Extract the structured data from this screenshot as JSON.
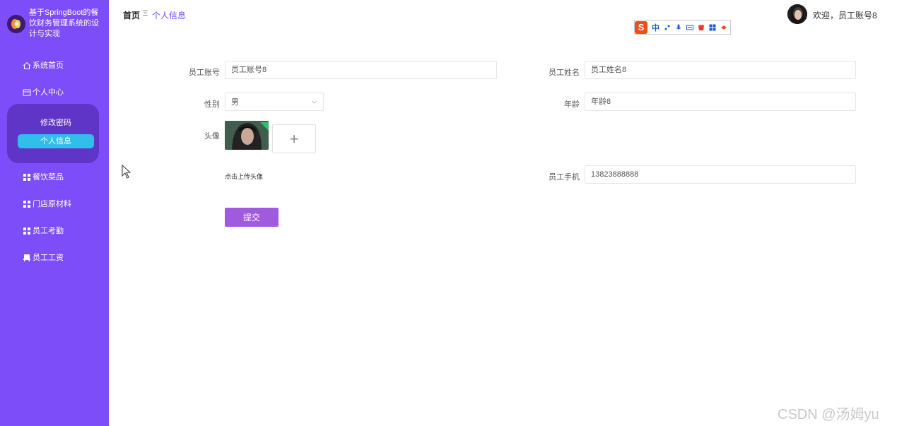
{
  "brand": {
    "title": "基于SpringBoot的餐饮财务管理系统的设计与实现"
  },
  "sidebar": {
    "items": [
      {
        "label": "系统首页",
        "icon": "home-icon"
      },
      {
        "label": "个人中心",
        "icon": "card-icon"
      },
      {
        "label": "餐饮菜品",
        "icon": "grid-icon"
      },
      {
        "label": "门店原材料",
        "icon": "grid-icon"
      },
      {
        "label": "员工考勤",
        "icon": "grid-icon"
      },
      {
        "label": "员工工资",
        "icon": "chair-icon"
      }
    ],
    "submenu": [
      {
        "label": "修改密码"
      },
      {
        "label": "个人信息",
        "active": true
      }
    ]
  },
  "header": {
    "breadcrumb_home": "首页",
    "breadcrumb_sep": "Ξ",
    "breadcrumb_current": "个人信息",
    "welcome": "欢迎，员工账号8"
  },
  "ime": {
    "lang": "中"
  },
  "form": {
    "account_label": "员工账号",
    "account_value": "员工账号8",
    "name_label": "员工姓名",
    "name_value": "员工姓名8",
    "gender_label": "性别",
    "gender_value": "男",
    "age_label": "年龄",
    "age_value": "年龄8",
    "avatar_label": "头像",
    "upload_plus": "+",
    "upload_hint": "点击上传头像",
    "phone_label": "员工手机",
    "phone_value": "13823888888",
    "submit_label": "提交"
  },
  "watermark": "CSDN @汤姆yu",
  "colors": {
    "sidebar": "#7d4dfa",
    "submenu": "#5f35c7",
    "active": "#2fbfea",
    "submit": "#a05ade"
  }
}
